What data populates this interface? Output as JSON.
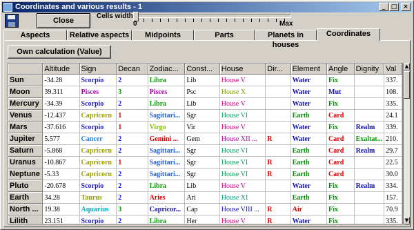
{
  "window": {
    "title": "Coordinates and various results - 1",
    "controls": {
      "minimize": "_",
      "maximize": "□",
      "close": "×"
    }
  },
  "toolbar": {
    "close_label": "Close",
    "cells_width_label": "Cells width",
    "slider_min": "0",
    "slider_max": "Max"
  },
  "tabs": [
    {
      "label": "Aspects"
    },
    {
      "label": "Relative aspects"
    },
    {
      "label": "Midpoints"
    },
    {
      "label": "Parts"
    },
    {
      "label": "Planets in houses"
    },
    {
      "label": "Coordinates",
      "active": true
    }
  ],
  "own_calculation_label": "Own calculation (Value)",
  "table": {
    "columns": [
      "",
      "Altitude",
      "Sign",
      "Decan",
      "Zodiac...",
      "Const...",
      "House",
      "Dir...",
      "Element",
      "Angle",
      "Dignity",
      "Val"
    ],
    "rows": [
      {
        "name": "Sun",
        "altitude": "-34.28",
        "sign": "Scorpio",
        "decan": "2",
        "zodiac": "Libra",
        "const": "Lib",
        "house": "House V",
        "dir": "",
        "element": "Water",
        "angle": "Fix",
        "dignity": "",
        "val": "337."
      },
      {
        "name": "Moon",
        "altitude": "39.311",
        "sign": "Pisces",
        "decan": "3",
        "zodiac": "Pisces",
        "const": "Psc",
        "house": "House X",
        "dir": "",
        "element": "Water",
        "angle": "Mut",
        "dignity": "",
        "val": "108."
      },
      {
        "name": "Mercury",
        "altitude": "-34.39",
        "sign": "Scorpio",
        "decan": "2",
        "zodiac": "Libra",
        "const": "Lib",
        "house": "House V",
        "dir": "",
        "element": "Water",
        "angle": "Fix",
        "dignity": "",
        "val": "335."
      },
      {
        "name": "Venus",
        "altitude": "-12.437",
        "sign": "Capricorn",
        "decan": "1",
        "zodiac": "Sagittari...",
        "const": "Sgr",
        "house": "House VI",
        "dir": "",
        "element": "Earth",
        "angle": "Card",
        "dignity": "",
        "val": "24.1"
      },
      {
        "name": "Mars",
        "altitude": "-37.616",
        "sign": "Scorpio",
        "decan": "1",
        "zodiac": "Virgo",
        "const": "Vir",
        "house": "House V",
        "dir": "",
        "element": "Water",
        "angle": "Fix",
        "dignity": "Realm",
        "val": "339."
      },
      {
        "name": "Jupiter",
        "altitude": "5.577",
        "sign": "Cancer",
        "decan": "2",
        "zodiac": "Gemini ...",
        "const": "Gem",
        "house": "House XII ...",
        "dir": "R",
        "element": "Water",
        "angle": "Card",
        "dignity": "Exaltat...",
        "val": "210."
      },
      {
        "name": "Saturn",
        "altitude": "-5.868",
        "sign": "Capricorn",
        "decan": "2",
        "zodiac": "Sagittari...",
        "const": "Sgr",
        "house": "House VI",
        "dir": "",
        "element": "Earth",
        "angle": "Card",
        "dignity": "Realm",
        "val": "29.7"
      },
      {
        "name": "Uranus",
        "altitude": "-10.867",
        "sign": "Capricorn",
        "decan": "1",
        "zodiac": "Sagittari...",
        "const": "Sgr",
        "house": "House VI",
        "dir": "R",
        "element": "Earth",
        "angle": "Card",
        "dignity": "",
        "val": "22.5"
      },
      {
        "name": "Neptune",
        "altitude": "-5.33",
        "sign": "Capricorn",
        "decan": "2",
        "zodiac": "Sagittari...",
        "const": "Sgr",
        "house": "House VI",
        "dir": "R",
        "element": "Earth",
        "angle": "Card",
        "dignity": "",
        "val": "30.0"
      },
      {
        "name": "Pluto",
        "altitude": "-20.678",
        "sign": "Scorpio",
        "decan": "2",
        "zodiac": "Libra",
        "const": "Lib",
        "house": "House V",
        "dir": "",
        "element": "Water",
        "angle": "Fix",
        "dignity": "Realm",
        "val": "334."
      },
      {
        "name": "Earth",
        "altitude": "34.28",
        "sign": "Taurus",
        "decan": "2",
        "zodiac": "Aries",
        "const": "Ari",
        "house": "House XI",
        "dir": "",
        "element": "Earth",
        "angle": "Fix",
        "dignity": "",
        "val": "157."
      },
      {
        "name": "North ...",
        "altitude": "19.38",
        "sign": "Aquarius",
        "decan": "3",
        "zodiac": "Capricor...",
        "const": "Cap",
        "house": "House VIII ...",
        "dir": "R",
        "element": "Air",
        "angle": "Fix",
        "dignity": "",
        "val": "70.9"
      },
      {
        "name": "Lilith",
        "altitude": "23.151",
        "sign": "Scorpio",
        "decan": "2",
        "zodiac": "Libra",
        "const": "Her",
        "house": "House V",
        "dir": "R",
        "element": "Water",
        "angle": "Fix",
        "dignity": "",
        "val": "335."
      },
      {
        "name": "East",
        "altitude": "0",
        "sign": "Gemini",
        "decan": "2",
        "zodiac": "Taurus",
        "const": "Ori",
        "house": "House IX",
        "dir": "",
        "element": "Air",
        "angle": "Mut",
        "dignity": "",
        "val": "188."
      }
    ]
  },
  "colors": {
    "signs": {
      "Scorpio": "#2020c0",
      "Pisces": "#b000b0",
      "Capricorn": "#a0a000",
      "Cancer": "#2080e0",
      "Taurus": "#90a000",
      "Aquarius": "#00b0c0",
      "Gemini": "#e08000",
      "Libra": "#00a000",
      "Virgo": "#80c000"
    },
    "zodiac": {
      "Libra": "#00a000",
      "Pisces": "#b000b0",
      "Sagittari...": "#2060e0",
      "Virgo": "#80c000",
      "Gemini ...": "#e00000",
      "Aries": "#e00000",
      "Capricor...": "#1010b0",
      "Taurus": "#c000a0"
    },
    "decan": {
      "1": "#e00000",
      "2": "#1010e0",
      "3": "#009000"
    },
    "house": {
      "House V": "#d00080",
      "House X": "#80a000",
      "House VI": "#00a060",
      "House XII ...": "#b000a0",
      "House XI": "#00a080",
      "House VIII ...": "#1010b0",
      "House IX": "#1010c0"
    },
    "element": {
      "Water": "#1010b0",
      "Earth": "#009000",
      "Air": "#d00000"
    },
    "angle": {
      "Fix": "#009000",
      "Mut": "#1010b0",
      "Card": "#e00000"
    },
    "dignity": {
      "Realm": "#1010b0",
      "Exaltat...": "#00a000"
    },
    "dir": "#e00000"
  }
}
